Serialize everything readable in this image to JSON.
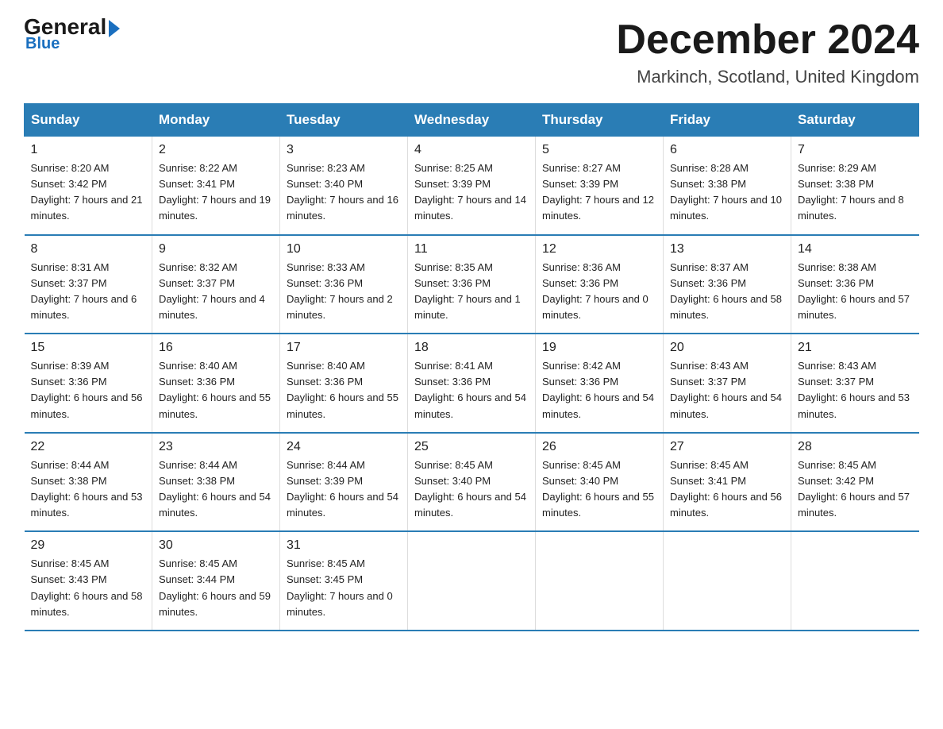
{
  "header": {
    "logo_general": "General",
    "logo_blue": "Blue",
    "month_title": "December 2024",
    "location": "Markinch, Scotland, United Kingdom"
  },
  "days_of_week": [
    "Sunday",
    "Monday",
    "Tuesday",
    "Wednesday",
    "Thursday",
    "Friday",
    "Saturday"
  ],
  "weeks": [
    [
      {
        "day": "1",
        "sunrise": "8:20 AM",
        "sunset": "3:42 PM",
        "daylight": "7 hours and 21 minutes."
      },
      {
        "day": "2",
        "sunrise": "8:22 AM",
        "sunset": "3:41 PM",
        "daylight": "7 hours and 19 minutes."
      },
      {
        "day": "3",
        "sunrise": "8:23 AM",
        "sunset": "3:40 PM",
        "daylight": "7 hours and 16 minutes."
      },
      {
        "day": "4",
        "sunrise": "8:25 AM",
        "sunset": "3:39 PM",
        "daylight": "7 hours and 14 minutes."
      },
      {
        "day": "5",
        "sunrise": "8:27 AM",
        "sunset": "3:39 PM",
        "daylight": "7 hours and 12 minutes."
      },
      {
        "day": "6",
        "sunrise": "8:28 AM",
        "sunset": "3:38 PM",
        "daylight": "7 hours and 10 minutes."
      },
      {
        "day": "7",
        "sunrise": "8:29 AM",
        "sunset": "3:38 PM",
        "daylight": "7 hours and 8 minutes."
      }
    ],
    [
      {
        "day": "8",
        "sunrise": "8:31 AM",
        "sunset": "3:37 PM",
        "daylight": "7 hours and 6 minutes."
      },
      {
        "day": "9",
        "sunrise": "8:32 AM",
        "sunset": "3:37 PM",
        "daylight": "7 hours and 4 minutes."
      },
      {
        "day": "10",
        "sunrise": "8:33 AM",
        "sunset": "3:36 PM",
        "daylight": "7 hours and 2 minutes."
      },
      {
        "day": "11",
        "sunrise": "8:35 AM",
        "sunset": "3:36 PM",
        "daylight": "7 hours and 1 minute."
      },
      {
        "day": "12",
        "sunrise": "8:36 AM",
        "sunset": "3:36 PM",
        "daylight": "7 hours and 0 minutes."
      },
      {
        "day": "13",
        "sunrise": "8:37 AM",
        "sunset": "3:36 PM",
        "daylight": "6 hours and 58 minutes."
      },
      {
        "day": "14",
        "sunrise": "8:38 AM",
        "sunset": "3:36 PM",
        "daylight": "6 hours and 57 minutes."
      }
    ],
    [
      {
        "day": "15",
        "sunrise": "8:39 AM",
        "sunset": "3:36 PM",
        "daylight": "6 hours and 56 minutes."
      },
      {
        "day": "16",
        "sunrise": "8:40 AM",
        "sunset": "3:36 PM",
        "daylight": "6 hours and 55 minutes."
      },
      {
        "day": "17",
        "sunrise": "8:40 AM",
        "sunset": "3:36 PM",
        "daylight": "6 hours and 55 minutes."
      },
      {
        "day": "18",
        "sunrise": "8:41 AM",
        "sunset": "3:36 PM",
        "daylight": "6 hours and 54 minutes."
      },
      {
        "day": "19",
        "sunrise": "8:42 AM",
        "sunset": "3:36 PM",
        "daylight": "6 hours and 54 minutes."
      },
      {
        "day": "20",
        "sunrise": "8:43 AM",
        "sunset": "3:37 PM",
        "daylight": "6 hours and 54 minutes."
      },
      {
        "day": "21",
        "sunrise": "8:43 AM",
        "sunset": "3:37 PM",
        "daylight": "6 hours and 53 minutes."
      }
    ],
    [
      {
        "day": "22",
        "sunrise": "8:44 AM",
        "sunset": "3:38 PM",
        "daylight": "6 hours and 53 minutes."
      },
      {
        "day": "23",
        "sunrise": "8:44 AM",
        "sunset": "3:38 PM",
        "daylight": "6 hours and 54 minutes."
      },
      {
        "day": "24",
        "sunrise": "8:44 AM",
        "sunset": "3:39 PM",
        "daylight": "6 hours and 54 minutes."
      },
      {
        "day": "25",
        "sunrise": "8:45 AM",
        "sunset": "3:40 PM",
        "daylight": "6 hours and 54 minutes."
      },
      {
        "day": "26",
        "sunrise": "8:45 AM",
        "sunset": "3:40 PM",
        "daylight": "6 hours and 55 minutes."
      },
      {
        "day": "27",
        "sunrise": "8:45 AM",
        "sunset": "3:41 PM",
        "daylight": "6 hours and 56 minutes."
      },
      {
        "day": "28",
        "sunrise": "8:45 AM",
        "sunset": "3:42 PM",
        "daylight": "6 hours and 57 minutes."
      }
    ],
    [
      {
        "day": "29",
        "sunrise": "8:45 AM",
        "sunset": "3:43 PM",
        "daylight": "6 hours and 58 minutes."
      },
      {
        "day": "30",
        "sunrise": "8:45 AM",
        "sunset": "3:44 PM",
        "daylight": "6 hours and 59 minutes."
      },
      {
        "day": "31",
        "sunrise": "8:45 AM",
        "sunset": "3:45 PM",
        "daylight": "7 hours and 0 minutes."
      },
      null,
      null,
      null,
      null
    ]
  ]
}
